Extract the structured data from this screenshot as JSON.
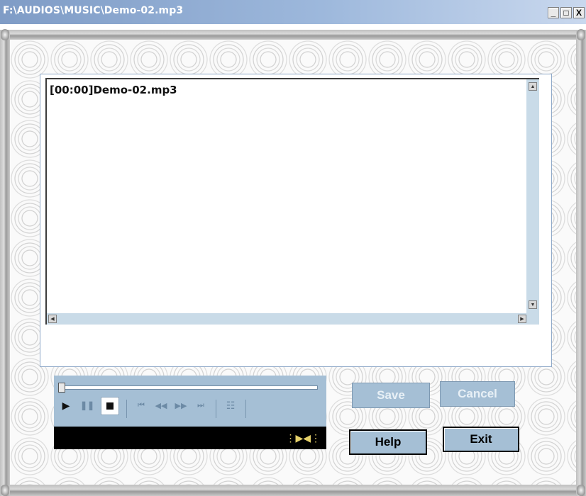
{
  "window": {
    "title": "F:\\AUDIOS\\MUSIC\\Demo-02.mp3",
    "controls": {
      "minimize": "_",
      "maximize": "□",
      "close": "X"
    }
  },
  "editor": {
    "text": "[00:00]Demo-02.mp3"
  },
  "player": {
    "seek_position": 0,
    "play_icon": "play-icon",
    "pause_icon": "pause-icon",
    "stop_icon": "stop-icon",
    "prev_track_icon": "previous-track-icon",
    "rewind_icon": "rewind-icon",
    "forward_icon": "fast-forward-icon",
    "next_track_icon": "next-track-icon",
    "playlist_icon": "playlist-icon",
    "status_icon": "status-indicator-icon"
  },
  "buttons": {
    "save": "Save",
    "cancel": "Cancel",
    "help": "Help",
    "exit": "Exit"
  },
  "colors": {
    "title_bar": "#7f9cc6",
    "player_panel": "#a5bfd5",
    "button_bg": "#a5bfd5"
  }
}
